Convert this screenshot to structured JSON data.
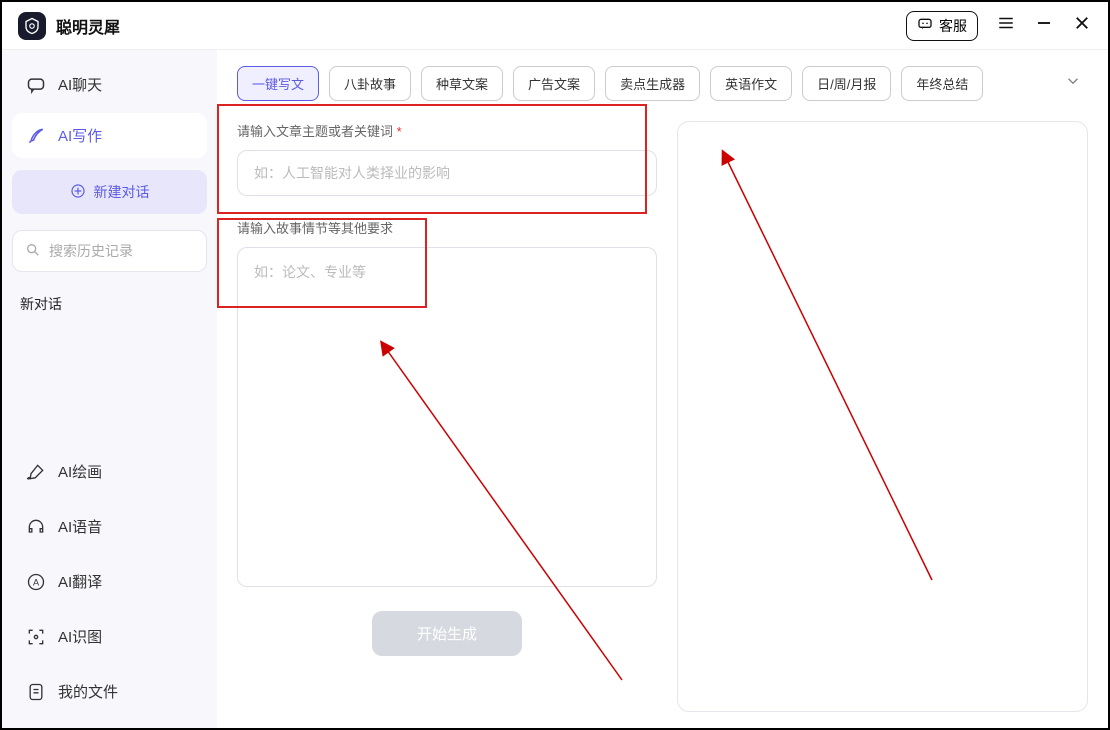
{
  "app": {
    "title": "聪明灵犀"
  },
  "titlebar": {
    "support": "客服"
  },
  "sidebar": {
    "nav": [
      {
        "label": "AI聊天"
      },
      {
        "label": "AI写作"
      }
    ],
    "new_chat": "新建对话",
    "search_placeholder": "搜索历史记录",
    "history_label": "新对话",
    "tools": [
      {
        "label": "AI绘画"
      },
      {
        "label": "AI语音"
      },
      {
        "label": "AI翻译"
      },
      {
        "label": "AI识图"
      },
      {
        "label": "我的文件"
      }
    ]
  },
  "tabs": [
    "一键写文",
    "八卦故事",
    "种草文案",
    "广告文案",
    "卖点生成器",
    "英语作文",
    "日/周/月报",
    "年终总结"
  ],
  "form": {
    "topic_label": "请输入文章主题或者关键词",
    "topic_placeholder": "如：人工智能对人类择业的影响",
    "detail_label": "请输入故事情节等其他要求",
    "detail_placeholder": "如：论文、专业等"
  },
  "actions": {
    "generate": "开始生成"
  }
}
